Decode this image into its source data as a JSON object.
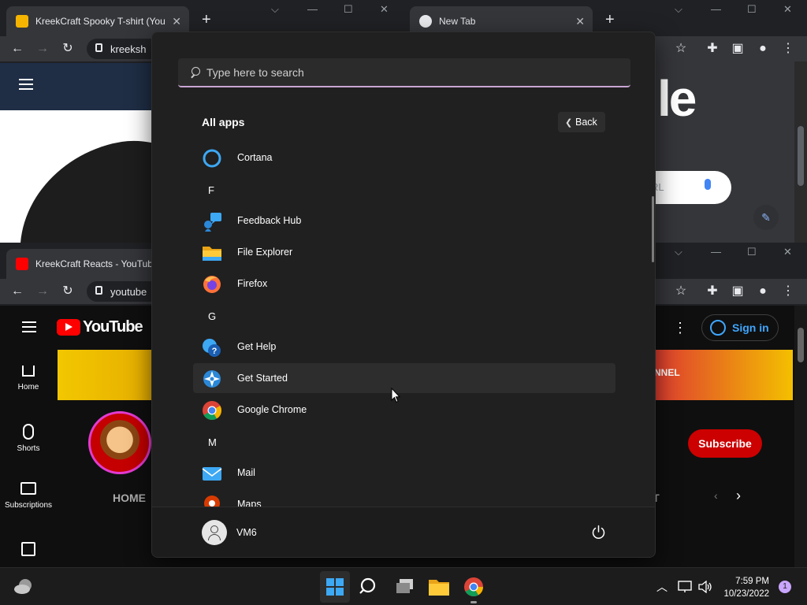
{
  "browser_top_left": {
    "tab_title": "KreekCraft Spooky T-shirt (Yout",
    "url": "kreeksh"
  },
  "browser_top_right": {
    "tab_title": "New Tab",
    "google_fragment": "le",
    "search_fragment": "RL"
  },
  "browser_bottom": {
    "tab_title": "KreekCraft Reacts - YouTube",
    "url": "youtube",
    "youtube_logo": "YouTube",
    "sign_in": "Sign in",
    "subscribe": "Subscribe",
    "home_tab": "HOME",
    "ut_fragment": "UT",
    "nnel_fragment": "NNEL",
    "sidebar": [
      "Home",
      "Shorts",
      "Subscriptions"
    ]
  },
  "start_menu": {
    "search_placeholder": "Type here to search",
    "all_apps_label": "All apps",
    "back_label": "Back",
    "apps": [
      {
        "type": "app",
        "name": "Cortana",
        "icon": "cortana-icon"
      },
      {
        "type": "letter",
        "name": "F"
      },
      {
        "type": "app",
        "name": "Feedback Hub",
        "icon": "feedback-hub-icon"
      },
      {
        "type": "app",
        "name": "File Explorer",
        "icon": "file-explorer-icon"
      },
      {
        "type": "app",
        "name": "Firefox",
        "icon": "firefox-icon"
      },
      {
        "type": "letter",
        "name": "G"
      },
      {
        "type": "app",
        "name": "Get Help",
        "icon": "get-help-icon"
      },
      {
        "type": "app",
        "name": "Get Started",
        "icon": "get-started-icon",
        "highlighted": true
      },
      {
        "type": "app",
        "name": "Google Chrome",
        "icon": "chrome-icon"
      },
      {
        "type": "letter",
        "name": "M"
      },
      {
        "type": "app",
        "name": "Mail",
        "icon": "mail-icon"
      },
      {
        "type": "app",
        "name": "Maps",
        "icon": "maps-icon"
      }
    ],
    "user_name": "VM6"
  },
  "taskbar": {
    "time": "7:59 PM",
    "date": "10/23/2022",
    "notification_count": "1"
  },
  "colors": {
    "start_bg": "#202020",
    "search_accent": "#c9a6d4",
    "youtube_red": "#cc0000",
    "windows_blue": "#3da8f4"
  }
}
